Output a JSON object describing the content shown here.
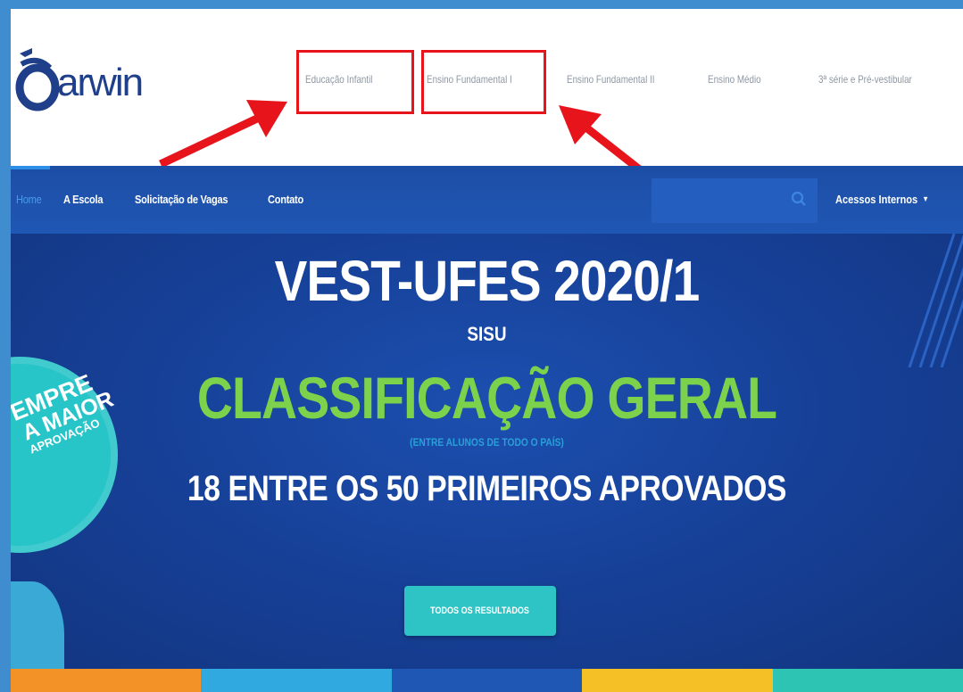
{
  "logo": {
    "text": "arwin"
  },
  "topnav": {
    "items": [
      "Educação Infantil",
      "Ensino Fundamental I",
      "Ensino Fundamental II",
      "Ensino Médio",
      "3ª série e Pré-vestibular"
    ]
  },
  "navbar": {
    "items": [
      "Home",
      "A Escola",
      "Solicitação de Vagas",
      "Contato"
    ],
    "acessos_label": "Acessos Internos"
  },
  "hero": {
    "title": "VEST-UFES 2020/1",
    "sisu": "SISU",
    "classification": "CLASSIFICAÇÃO GERAL",
    "note": "(ENTRE ALUNOS DE TODO O PAÍS)",
    "subtitle": "18 ENTRE OS 50 PRIMEIROS APROVADOS",
    "button_label": "TODOS OS RESULTADOS",
    "badge_lines": [
      "EMPRE",
      "A MAIOR",
      "APROVAÇÃO"
    ]
  },
  "colors": {
    "background_border": "#3f8ccf",
    "navbar": "#1d4ea6",
    "hero": "#163f95",
    "accent_green": "#7cd34b",
    "button": "#2ec4c6",
    "highlight_red": "#e8141c",
    "stripe": [
      "#f39226",
      "#2fa9df",
      "#1f57b4",
      "#f5c026",
      "#2ec4b4"
    ]
  }
}
